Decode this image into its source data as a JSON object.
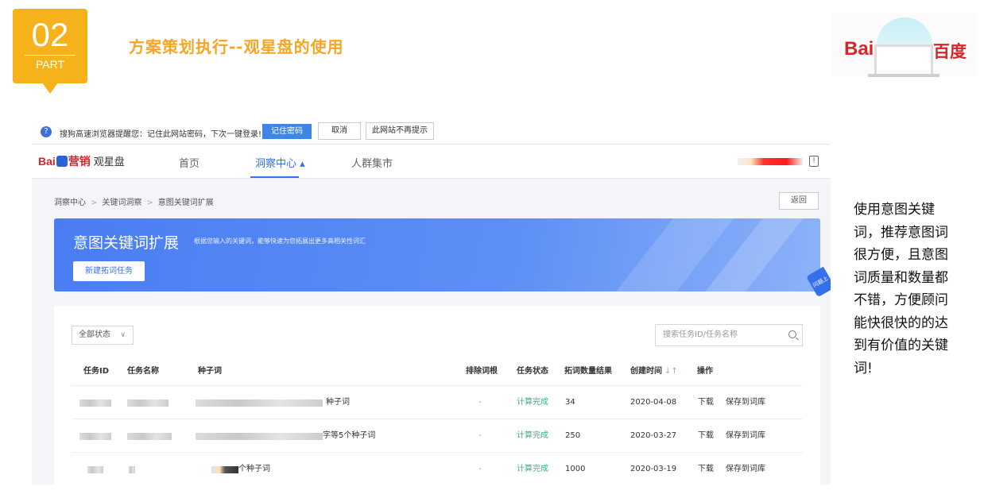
{
  "slide": {
    "part_number": "02",
    "part_label": "PART",
    "title": "方案策划执行--观星盘的使用",
    "logo_bai": "Bai",
    "logo_cn": "百度"
  },
  "browser_prompt": {
    "message": "搜狗高速浏览器提醒您：记住此网站密码，下次一键登录!",
    "save_button": "记住密码",
    "cancel_button": "取消",
    "never_button": "此网站不再提示"
  },
  "app": {
    "logo_bai": "Bai",
    "logo_brand": "营销",
    "product": "观星盘",
    "nav": [
      {
        "label": "首页"
      },
      {
        "label": "洞察中心 ▴"
      },
      {
        "label": "人群集市"
      }
    ],
    "breadcrumb": [
      "洞察中心",
      "关键词洞察",
      "意图关键词扩展"
    ],
    "back_button": "返回",
    "banner": {
      "title": "意图关键词扩展",
      "description": "根据您输入的关键词，能够快速为您拓展出更多高相关性词汇",
      "new_task_button": "新建拓词任务"
    },
    "side_tab": "问题上",
    "filter": {
      "selected": "全部状态"
    },
    "search": {
      "placeholder": "搜索任务ID/任务名称"
    },
    "table": {
      "columns": [
        "任务ID",
        "任务名称",
        "种子词",
        "排除词根",
        "任务状态",
        "拓词数量结果",
        "创建时间",
        "操作"
      ],
      "rows": [
        {
          "seed_suffix": "种子词",
          "excluded": "-",
          "status": "计算完成",
          "count": "34",
          "created": "2020-04-08",
          "action_download": "下载",
          "action_save": "保存到词库"
        },
        {
          "seed_suffix": "字等5个种子词",
          "excluded": "-",
          "status": "计算完成",
          "count": "250",
          "created": "2020-03-27",
          "action_download": "下载",
          "action_save": "保存到词库"
        },
        {
          "seed_suffix": "个种子词",
          "excluded": "-",
          "status": "计算完成",
          "count": "1000",
          "created": "2020-03-19",
          "action_download": "下载",
          "action_save": "保存到词库"
        }
      ]
    }
  },
  "caption": "使用意图关键词，推荐意图词很方便，且意图词质量和数量都不错，方便顾问能快很快的的达到有价值的关键词!",
  "colors": {
    "accent_orange": "#f6b21a",
    "baidu_red": "#d7252a",
    "primary_blue": "#3570ea",
    "status_green": "#3db07d"
  }
}
